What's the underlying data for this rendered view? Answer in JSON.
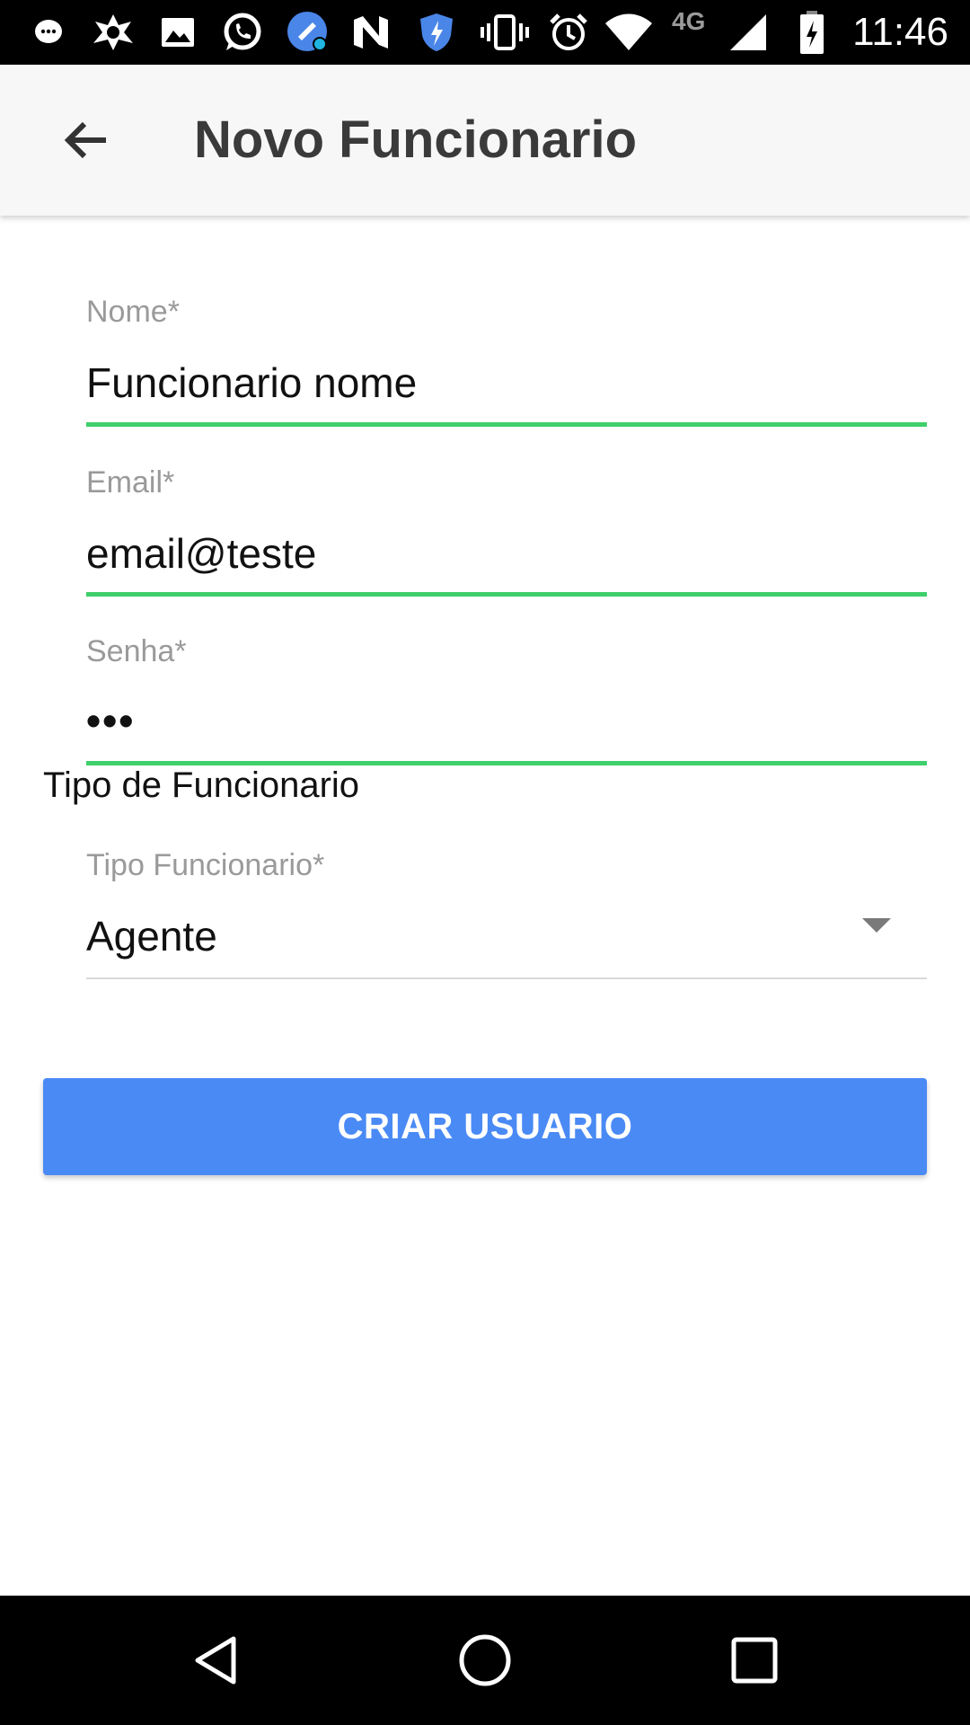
{
  "status_bar": {
    "time": "11:46",
    "network": "4G",
    "icons": [
      "messenger-icon",
      "avast-icon",
      "gallery-icon",
      "whatsapp-icon",
      "cleaner-icon",
      "nfc-icon",
      "shield-icon",
      "vibrate-icon",
      "alarm-icon",
      "wifi-icon",
      "signal-icon",
      "battery-charging-icon"
    ]
  },
  "app_bar": {
    "title": "Novo Funcionario",
    "back_icon": "arrow-back-icon"
  },
  "form": {
    "name": {
      "label": "Nome*",
      "value": "Funcionario nome"
    },
    "email": {
      "label": "Email*",
      "value": "email@teste"
    },
    "password": {
      "label": "Senha*",
      "value": "•••"
    },
    "section_title": "Tipo de Funcionario",
    "type": {
      "label": "Tipo Funcionario*",
      "value": "Agente"
    },
    "accent_color": "#3fcf6b"
  },
  "submit_button": {
    "label": "CRIAR USUARIO",
    "color": "#4a8af5"
  },
  "nav_bar": {
    "icons": [
      "back-triangle-icon",
      "home-circle-icon",
      "recents-square-icon"
    ]
  }
}
